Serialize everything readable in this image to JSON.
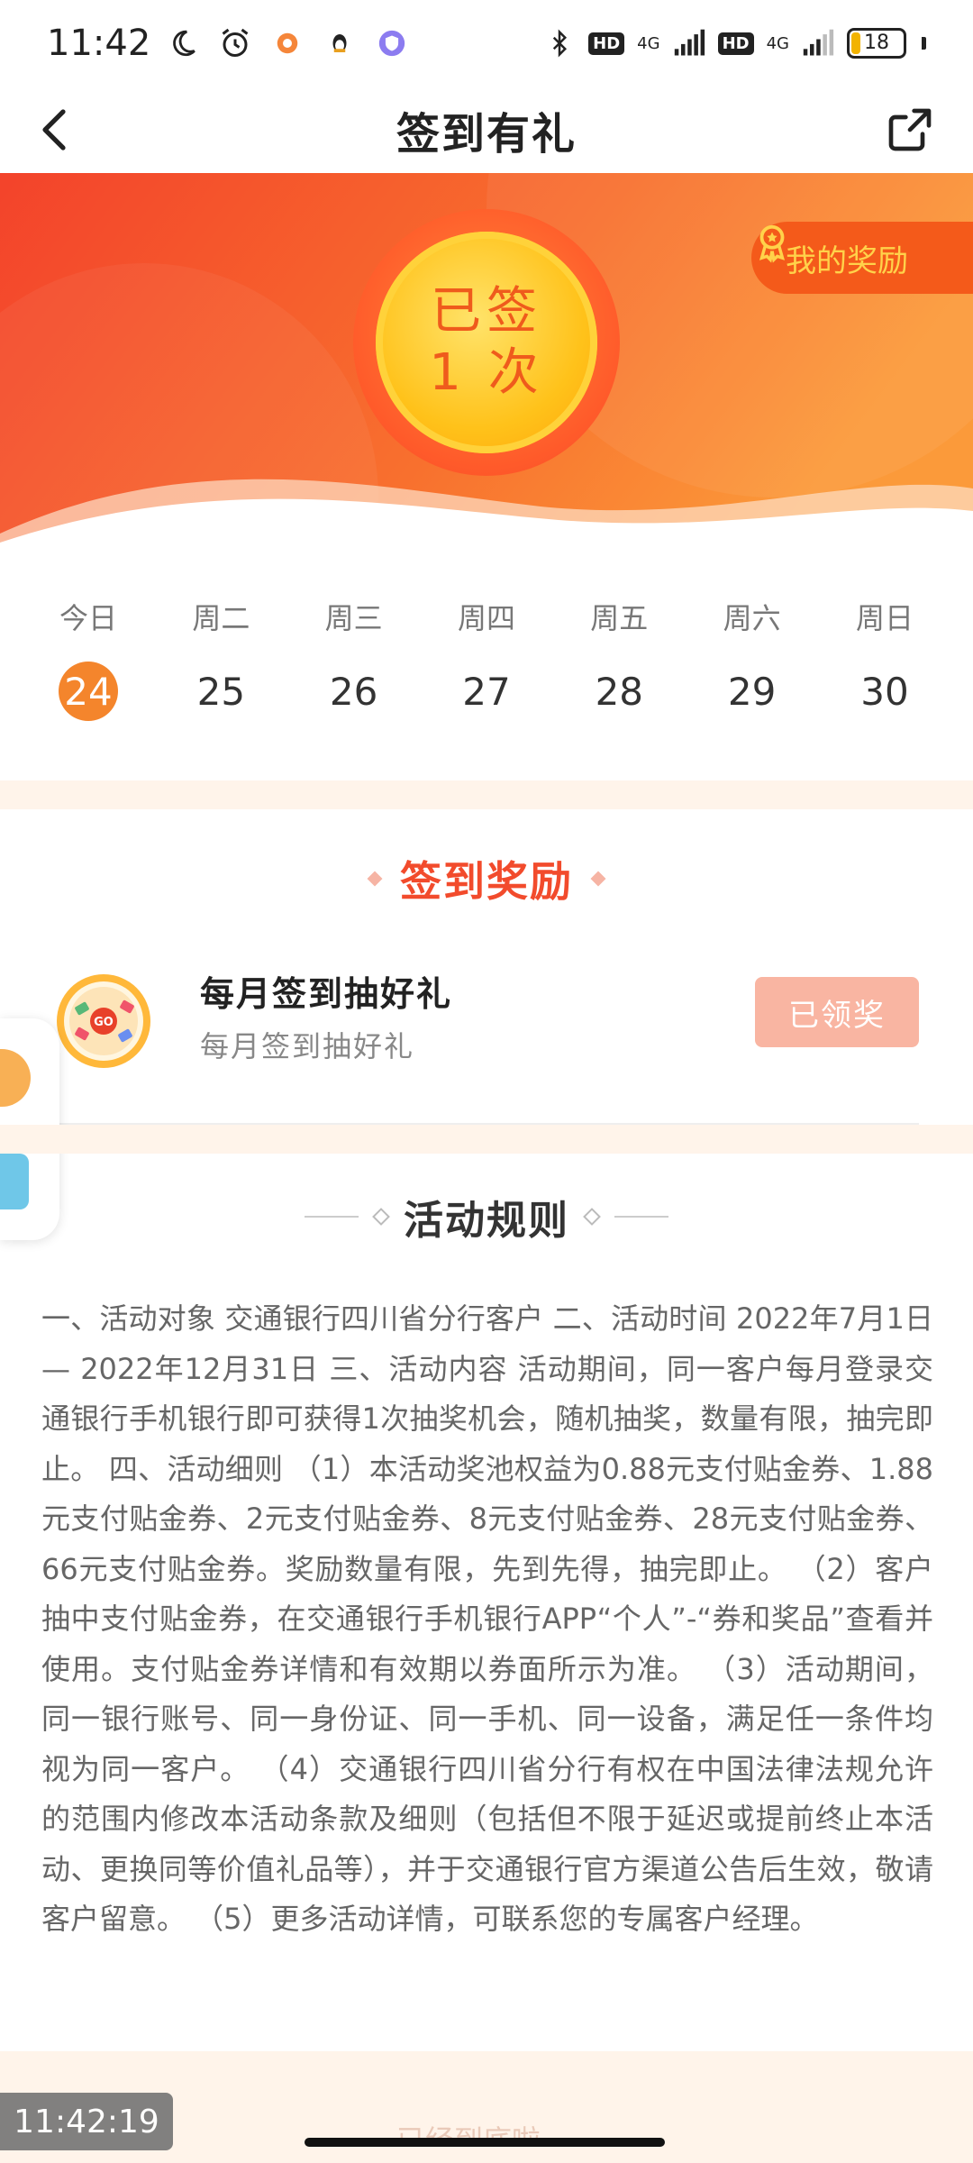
{
  "status_bar": {
    "time": "11:42",
    "network1": "4G",
    "network2": "4G",
    "hd1": "HD",
    "hd2": "HD",
    "battery": "18",
    "battery_level": 0.18
  },
  "nav": {
    "title": "签到有礼"
  },
  "banner": {
    "signed_line1": "已签",
    "signed_line2": "1 次",
    "my_rewards": "我的奖励",
    "colors": {
      "primary": "#ff5a2a",
      "gold": "#ffc21a",
      "accent": "#f24b2c"
    }
  },
  "week": {
    "days": [
      {
        "label": "今日",
        "num": "24",
        "today": true
      },
      {
        "label": "周二",
        "num": "25",
        "today": false
      },
      {
        "label": "周三",
        "num": "26",
        "today": false
      },
      {
        "label": "周四",
        "num": "27",
        "today": false
      },
      {
        "label": "周五",
        "num": "28",
        "today": false
      },
      {
        "label": "周六",
        "num": "29",
        "today": false
      },
      {
        "label": "周日",
        "num": "30",
        "today": false
      }
    ]
  },
  "rewards": {
    "section_title": "签到奖励",
    "item": {
      "name": "每月签到抽好礼",
      "desc": "每月签到抽好礼",
      "button": "已领奖",
      "icon_text": "GO"
    }
  },
  "rules": {
    "title": "活动规则",
    "text": "一、活动对象 交通银行四川省分行客户 二、活动时间 2022年7月1日— 2022年12月31日 三、活动内容 活动期间，同一客户每月登录交通银行手机银行即可获得1次抽奖机会，随机抽奖，数量有限，抽完即止。 四、活动细则 （1）本活动奖池权益为0.88元支付贴金券、1.88元支付贴金券、2元支付贴金券、8元支付贴金券、28元支付贴金券、66元支付贴金券。奖励数量有限，先到先得，抽完即止。 （2）客户抽中支付贴金券，在交通银行手机银行APP“个人”-“券和奖品”查看并使用。支付贴金券详情和有效期以券面所示为准。 （3）活动期间，同一银行账号、同一身份证、同一手机、同一设备，满足任一条件均视为同一客户。 （4）交通银行四川省分行有权在中国法律法规允许的范围内修改本活动条款及细则（包括但不限于延迟或提前终止本活动、更换同等价值礼品等），并于交通银行官方渠道公告后生效，敬请客户留意。 （5）更多活动详情，可联系您的专属客户经理。"
  },
  "overlay": {
    "time_badge": "11:42:19",
    "bottom_peek": "已经到底啦"
  }
}
